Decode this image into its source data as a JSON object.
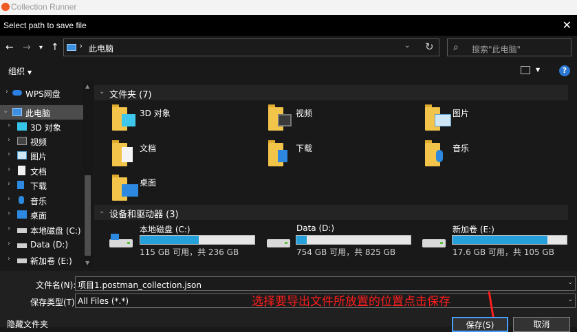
{
  "app": {
    "title": "Collection Runner"
  },
  "dialog": {
    "title": "Select path to save file",
    "close": "✕"
  },
  "nav": {
    "back": "←",
    "forward": "→",
    "history": "▾",
    "up": "↑",
    "address": "此电脑",
    "address_sep": "›",
    "address_dd": "⌄",
    "refresh": "↻",
    "search_placeholder": "搜索\"此电脑\"",
    "search_icon": "⌕"
  },
  "toolbar": {
    "organize": "组织",
    "organize_caret": "▼",
    "view_caret": "▼",
    "help": "?"
  },
  "sidebar": {
    "items": [
      {
        "label": "WPS网盘",
        "arrow": "›",
        "icon": "cloud-icon"
      },
      {
        "label": "此电脑",
        "arrow": "⌄",
        "icon": "computer-icon",
        "selected": true
      },
      {
        "label": "3D 对象",
        "arrow": "›",
        "icon": "cube-icon"
      },
      {
        "label": "视频",
        "arrow": "›",
        "icon": "video-icon"
      },
      {
        "label": "图片",
        "arrow": "›",
        "icon": "picture-icon"
      },
      {
        "label": "文档",
        "arrow": "›",
        "icon": "document-icon"
      },
      {
        "label": "下载",
        "arrow": "›",
        "icon": "download-icon"
      },
      {
        "label": "音乐",
        "arrow": "›",
        "icon": "music-icon"
      },
      {
        "label": "桌面",
        "arrow": "›",
        "icon": "desktop-icon"
      },
      {
        "label": "本地磁盘 (C:)",
        "arrow": "›",
        "icon": "drive-icon"
      },
      {
        "label": "Data (D:)",
        "arrow": "›",
        "icon": "drive-icon"
      },
      {
        "label": "新加卷 (E:)",
        "arrow": "›",
        "icon": "drive-icon"
      }
    ],
    "scroll_up": "▲",
    "scroll_down": "▼"
  },
  "content": {
    "folders_header": "文件夹 (7)",
    "folders_chevron": "⌄",
    "folders": [
      {
        "label": "3D 对象",
        "icon": "cube-icon"
      },
      {
        "label": "视频",
        "icon": "video-icon"
      },
      {
        "label": "图片",
        "icon": "picture-icon"
      },
      {
        "label": "文档",
        "icon": "document-icon"
      },
      {
        "label": "下载",
        "icon": "download-icon"
      },
      {
        "label": "音乐",
        "icon": "music-icon"
      },
      {
        "label": "桌面",
        "icon": "desktop-icon"
      }
    ],
    "drives_header": "设备和驱动器 (3)",
    "drives_chevron": "⌄",
    "drives": [
      {
        "name": "本地磁盘 (C:)",
        "free": "115 GB 可用，共 236 GB",
        "used_fraction": 0.51
      },
      {
        "name": "Data (D:)",
        "free": "754 GB 可用，共 825 GB",
        "used_fraction": 0.09
      },
      {
        "name": "新加卷 (E:)",
        "free": "17.6 GB 可用，共 105 GB",
        "used_fraction": 0.83
      }
    ]
  },
  "form": {
    "filename_label": "文件名(N):",
    "filename_value": "项目1.postman_collection.json",
    "filetype_label": "保存类型(T):",
    "filetype_value": "All Files (*.*)",
    "dd": "⌄"
  },
  "annotation": "选择要导出文件所放置的位置点击保存",
  "buttons": {
    "hide_folders": "隐藏文件夹",
    "save": "保存(S)",
    "cancel": "取消"
  },
  "colors": {
    "accent": "#26a0da",
    "folder": "#f2c54a",
    "annotation": "#ff1d1d"
  }
}
